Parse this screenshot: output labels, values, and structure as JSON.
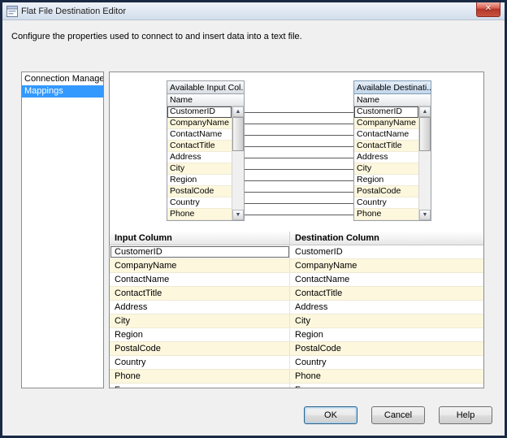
{
  "window": {
    "title": "Flat File Destination Editor",
    "description": "Configure the properties used to connect to and insert data into a text file."
  },
  "icons": {
    "close": "✕",
    "scroll_up": "▲",
    "scroll_down": "▼"
  },
  "nav": {
    "items": [
      {
        "label": "Connection Manager",
        "selected": false
      },
      {
        "label": "Mappings",
        "selected": true
      }
    ]
  },
  "mapping": {
    "input_box": {
      "title": "Available Input Col...",
      "column_header": "Name"
    },
    "dest_box": {
      "title": "Available Destinati...",
      "column_header": "Name"
    },
    "columns": [
      "CustomerID",
      "CompanyName",
      "ContactName",
      "ContactTitle",
      "Address",
      "City",
      "Region",
      "PostalCode",
      "Country",
      "Phone"
    ]
  },
  "grid": {
    "headers": [
      "Input Column",
      "Destination Column"
    ],
    "rows": [
      [
        "CustomerID",
        "CustomerID"
      ],
      [
        "CompanyName",
        "CompanyName"
      ],
      [
        "ContactName",
        "ContactName"
      ],
      [
        "ContactTitle",
        "ContactTitle"
      ],
      [
        "Address",
        "Address"
      ],
      [
        "City",
        "City"
      ],
      [
        "Region",
        "Region"
      ],
      [
        "PostalCode",
        "PostalCode"
      ],
      [
        "Country",
        "Country"
      ],
      [
        "Phone",
        "Phone"
      ]
    ],
    "partial_row": [
      "Fax",
      "Fax"
    ]
  },
  "buttons": [
    {
      "label": "OK",
      "focused": true
    },
    {
      "label": "Cancel",
      "focused": false
    },
    {
      "label": "Help",
      "focused": false
    }
  ],
  "colors": {
    "selection": "#3399FF",
    "row_alt": "#FCF7DD",
    "connector": "#5B5B5B",
    "frame": "#1B2A44"
  }
}
